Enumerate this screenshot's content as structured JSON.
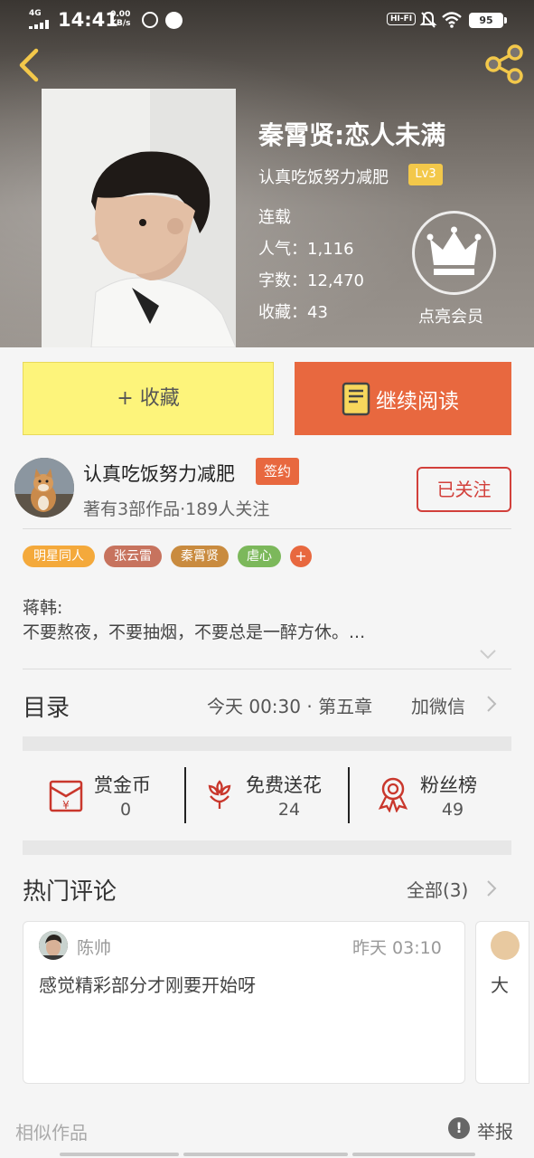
{
  "status_bar": {
    "network": "4G",
    "time": "14:41",
    "speed_value": "0.00",
    "speed_unit": "KB/s",
    "hifi": "HI-FI",
    "battery": "95"
  },
  "nav": {
    "back_icon": "chevron-left-icon",
    "share_icon": "share-icon"
  },
  "book": {
    "title": "秦霄贤:恋人未满",
    "author": "认真吃饭努力减肥",
    "level": "Lv3",
    "status": "连载",
    "popularity": "人气：1,116",
    "word_count": "字数：12,470",
    "favorites": "收藏：43",
    "vip_label": "点亮会员"
  },
  "actions": {
    "collect_label": "+ 收藏",
    "read_label": "继续阅读"
  },
  "author_card": {
    "name": "认真吃饭努力减肥",
    "signed_badge": "签约",
    "summary": "著有3部作品·189人关注",
    "follow_label": "已关注"
  },
  "tags": [
    {
      "label": "明星同人",
      "color": "#f4a93b"
    },
    {
      "label": "张云雷",
      "color": "#c7735e"
    },
    {
      "label": "秦霄贤",
      "color": "#c98b3f"
    },
    {
      "label": "虐心",
      "color": "#7cb85b"
    }
  ],
  "tag_add": "+",
  "intro": {
    "line1": "蒋韩:",
    "line2": "不要熬夜，不要抽烟，不要总是一醉方休。..."
  },
  "catalog": {
    "label": "目录",
    "latest": "今天 00:30 · 第五章",
    "wechat": "加微信"
  },
  "stats": [
    {
      "name": "赏金币",
      "value": "0",
      "icon": "red-envelope-icon"
    },
    {
      "name": "免费送花",
      "value": "24",
      "icon": "flower-icon"
    },
    {
      "name": "粉丝榜",
      "value": "49",
      "icon": "award-ribbon-icon"
    }
  ],
  "comments": {
    "title": "热门评论",
    "all_label": "全部(3)",
    "items": [
      {
        "user": "陈帅",
        "time": "昨天 03:10",
        "text": "感觉精彩部分才刚要开始呀"
      },
      {
        "text": "大"
      }
    ]
  },
  "footer": {
    "similar": "相似作品",
    "report": "举报",
    "report_icon": "!"
  },
  "colors": {
    "accent": "#e8683f",
    "collect_bg": "#fdf47b",
    "follow": "#d2403b",
    "level": "#f3c84a"
  }
}
